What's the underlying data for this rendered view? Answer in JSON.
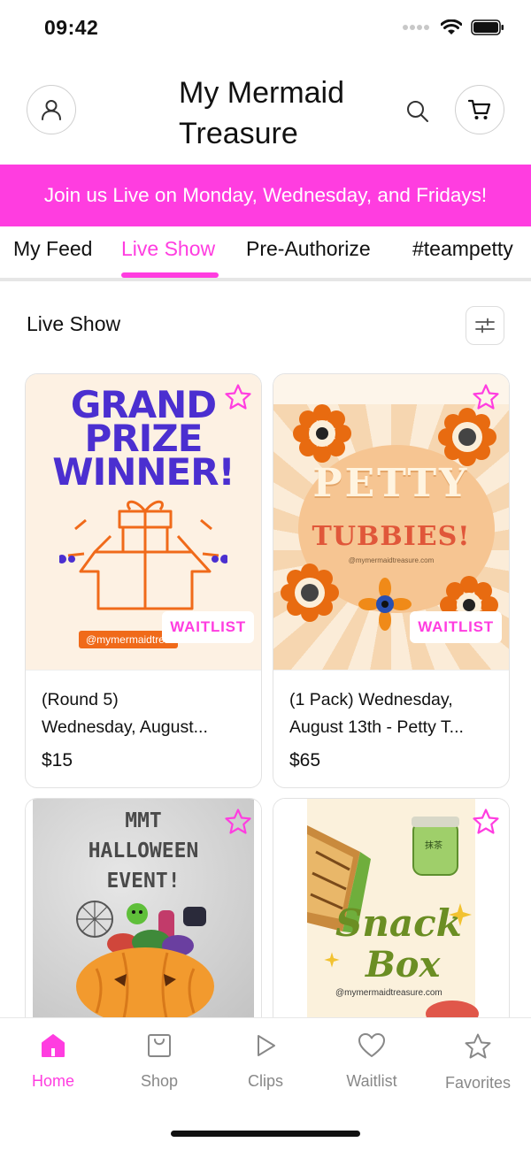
{
  "status_bar": {
    "time": "09:42"
  },
  "header": {
    "title_line1": "My Mermaid",
    "title_line2": "Treasure"
  },
  "banner": {
    "text": "Join us Live on Monday, Wednesday, and Fridays!"
  },
  "tabs": [
    {
      "label": "My Feed",
      "active": false
    },
    {
      "label": "Live Show",
      "active": true
    },
    {
      "label": "Pre-Authorize",
      "active": false
    },
    {
      "label": "#teampetty",
      "active": false
    }
  ],
  "section": {
    "title": "Live Show"
  },
  "cards": [
    {
      "image": {
        "line1": "GRAND",
        "line2": "PRIZE",
        "line3": "WINNER!",
        "handle": "@mymermaidtrea"
      },
      "badge": "WAITLIST",
      "title_line1": "(Round 5)",
      "title_line2": "Wednesday, August...",
      "price": "$15"
    },
    {
      "image": {
        "line1": "PETTY",
        "line2": "TUBBIES!",
        "handle": "@mymermaidtreasure.com"
      },
      "badge": "WAITLIST",
      "title_line1": "(1 Pack) Wednesday,",
      "title_line2": "August 13th - Petty T...",
      "price": "$65"
    },
    {
      "image": {
        "line1": "MMT",
        "line2": "HALLOWEEN",
        "line3": "EVENT!"
      }
    },
    {
      "image": {
        "line1": "Snack",
        "line2": "Box",
        "handle": "@mymermaidtreasure.com",
        "jar_text": "抹茶"
      }
    }
  ],
  "bottom_nav": [
    {
      "label": "Home",
      "icon": "home-icon",
      "active": true
    },
    {
      "label": "Shop",
      "icon": "shopping-bag-icon",
      "active": false
    },
    {
      "label": "Clips",
      "icon": "play-icon",
      "active": false
    },
    {
      "label": "Waitlist",
      "icon": "heart-icon",
      "active": false
    },
    {
      "label": "Favorites",
      "icon": "star-icon",
      "active": false
    }
  ],
  "colors": {
    "accent": "#ff3de0",
    "inactive": "#888888"
  }
}
